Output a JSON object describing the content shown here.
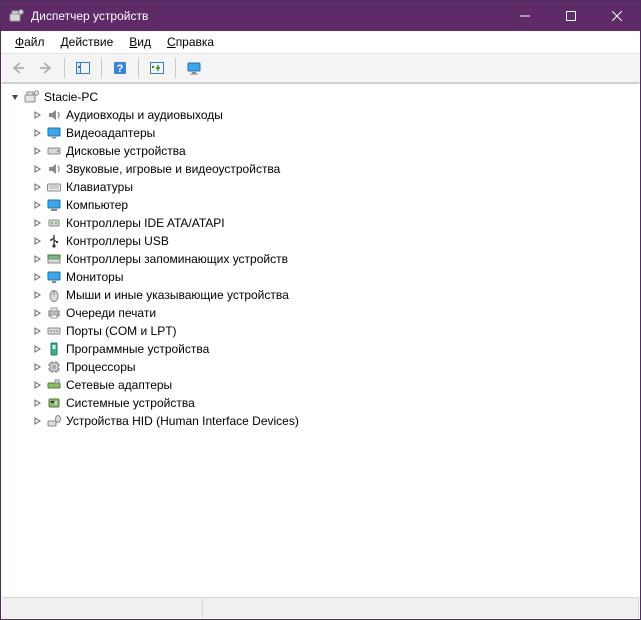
{
  "title": "Диспетчер устройств",
  "menu": {
    "file": {
      "u": "Ф",
      "rest": "айл"
    },
    "action": {
      "u": "Д",
      "rest": "ействие"
    },
    "view": {
      "u": "В",
      "rest": "ид"
    },
    "help": {
      "u": "С",
      "rest": "правка"
    }
  },
  "root": {
    "label": "Stacie-PC"
  },
  "categories": [
    {
      "icon": "audio",
      "label": "Аудиовходы и аудиовыходы"
    },
    {
      "icon": "display",
      "label": "Видеоадаптеры"
    },
    {
      "icon": "disk",
      "label": "Дисковые устройства"
    },
    {
      "icon": "audio",
      "label": "Звуковые, игровые и видеоустройства"
    },
    {
      "icon": "keyboard",
      "label": "Клавиатуры"
    },
    {
      "icon": "computer",
      "label": "Компьютер"
    },
    {
      "icon": "ide",
      "label": "Контроллеры IDE ATA/ATAPI"
    },
    {
      "icon": "usb",
      "label": "Контроллеры USB"
    },
    {
      "icon": "storage",
      "label": "Контроллеры запоминающих устройств"
    },
    {
      "icon": "monitor",
      "label": "Мониторы"
    },
    {
      "icon": "mouse",
      "label": "Мыши и иные указывающие устройства"
    },
    {
      "icon": "printer",
      "label": "Очереди печати"
    },
    {
      "icon": "ports",
      "label": "Порты (COM и LPT)"
    },
    {
      "icon": "software",
      "label": "Программные устройства"
    },
    {
      "icon": "cpu",
      "label": "Процессоры"
    },
    {
      "icon": "network",
      "label": "Сетевые адаптеры"
    },
    {
      "icon": "system",
      "label": "Системные устройства"
    },
    {
      "icon": "hid",
      "label": "Устройства HID (Human Interface Devices)"
    }
  ]
}
